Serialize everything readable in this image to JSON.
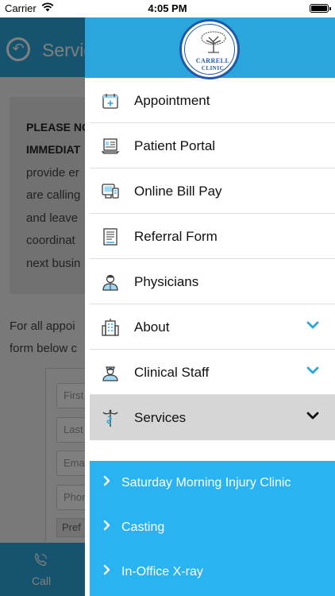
{
  "status_bar": {
    "carrier": "Carrier",
    "time": "4:05 PM"
  },
  "background": {
    "title": "Servic",
    "notice_lines": [
      "PLEASE NO",
      "IMMEDIAT",
      "provide er",
      "are calling",
      "and leave",
      "coordinat",
      "next busin"
    ],
    "body_lines": [
      "For all appoi",
      "form below c"
    ],
    "fields": [
      "First",
      "Last",
      "Ema",
      "Phon"
    ],
    "pref": "Pref",
    "tab_call": "Call"
  },
  "drawer": {
    "logo": {
      "line1": "CARRELL",
      "line2": "CLINIC"
    },
    "menu": [
      {
        "label": "Appointment",
        "icon": "calendar-plus-icon",
        "expandable": false
      },
      {
        "label": "Patient Portal",
        "icon": "laptop-icon",
        "expandable": false
      },
      {
        "label": "Online Bill Pay",
        "icon": "bill-pay-icon",
        "expandable": false
      },
      {
        "label": "Referral Form",
        "icon": "document-icon",
        "expandable": false
      },
      {
        "label": "Physicians",
        "icon": "doctor-icon",
        "expandable": false
      },
      {
        "label": "About",
        "icon": "building-icon",
        "expandable": true
      },
      {
        "label": "Clinical Staff",
        "icon": "nurse-icon",
        "expandable": true
      },
      {
        "label": "Services",
        "icon": "caduceus-icon",
        "expandable": true,
        "active": true
      }
    ],
    "submenu": [
      {
        "label": "Saturday Morning Injury Clinic"
      },
      {
        "label": "Casting"
      },
      {
        "label": "In-Office X-ray"
      }
    ]
  },
  "colors": {
    "brand_blue": "#2aa6dd",
    "submenu_blue": "#2ab3f1",
    "chevron_blue": "#2aa6dd",
    "logo_blue": "#1e5aa8"
  }
}
